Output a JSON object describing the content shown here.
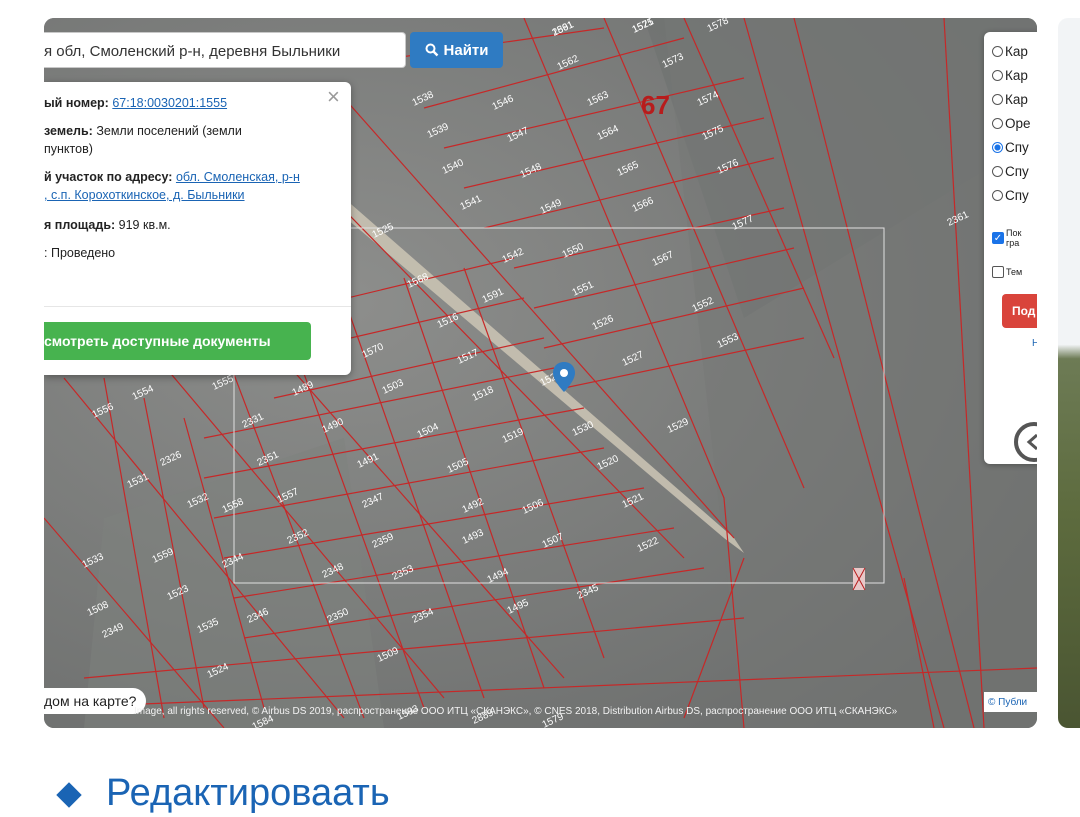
{
  "search": {
    "query": "я обл, Смоленский р-н, деревня Быльники",
    "button_label": "Найти"
  },
  "popup": {
    "cadastral_label": "ый номер:",
    "cadastral_value": "67:18:0030201:1555",
    "category_label": "земель:",
    "category_value": "Земли поселений (земли",
    "category_value_2": "пунктов)",
    "address_label": "й участок по адресу:",
    "address_value": "обл. Смоленская, р-н",
    "address_value_2": ", с.п. Корохоткинское, д. Быльники",
    "area_label": "я площадь:",
    "area_value": "919 кв.м.",
    "status_label": ":",
    "status_value": "Проведено",
    "docs_button": "смотреть доступные документы"
  },
  "map": {
    "region_number": "67",
    "parcel_labels": [
      "1561",
      "1571",
      "1578",
      "1562",
      "1573",
      "1538",
      "1546",
      "1563",
      "1574",
      "1539",
      "1547",
      "1564",
      "1575",
      "1540",
      "1548",
      "1565",
      "1576",
      "1541",
      "1549",
      "1566",
      "1577",
      "2361",
      "1525",
      "1542",
      "1550",
      "1567",
      "1591",
      "1551",
      "1568",
      "1526",
      "1552",
      "1569",
      "1516",
      "1527",
      "1553",
      "1570",
      "1517",
      "1528",
      "1555",
      "1489",
      "1503",
      "1518",
      "1529",
      "1554",
      "2331",
      "1490",
      "1504",
      "1519",
      "1530",
      "1556",
      "2326",
      "2351",
      "1491",
      "1505",
      "1520",
      "1531",
      "1557",
      "2347",
      "1492",
      "1506",
      "1521",
      "1532",
      "1558",
      "2352",
      "2359",
      "1493",
      "1507",
      "1522",
      "1533",
      "1559",
      "2344",
      "2348",
      "2353",
      "1494",
      "1508",
      "1523",
      "2345",
      "2349",
      "1535",
      "2346",
      "2350",
      "2354",
      "1495",
      "1509",
      "1524",
      "1593",
      "2889",
      "1579",
      "1584",
      "1586",
      "2891",
      "1525"
    ],
    "attribution": "Image, all rights reserved, © Airbus DS 2019, распространение ООО ИТЦ «СКАНЭКС», © CNES 2018, Distribution Airbus DS, распространение ООО ИТЦ «СКАНЭКС»",
    "where_label": "дом на карте?",
    "public_label": "© Публи"
  },
  "layers": {
    "options": [
      "Кар",
      "Кар",
      "Кар",
      "Оре",
      "Спу",
      "Спу",
      "Спу"
    ],
    "selected_index": 4,
    "checkboxes": [
      {
        "label": "Пок",
        "label_2": "гра",
        "checked": true
      },
      {
        "label": "Тем",
        "checked": false
      }
    ],
    "red_button": "Под",
    "link": "Н"
  },
  "edit_link": "Редактироваать"
}
